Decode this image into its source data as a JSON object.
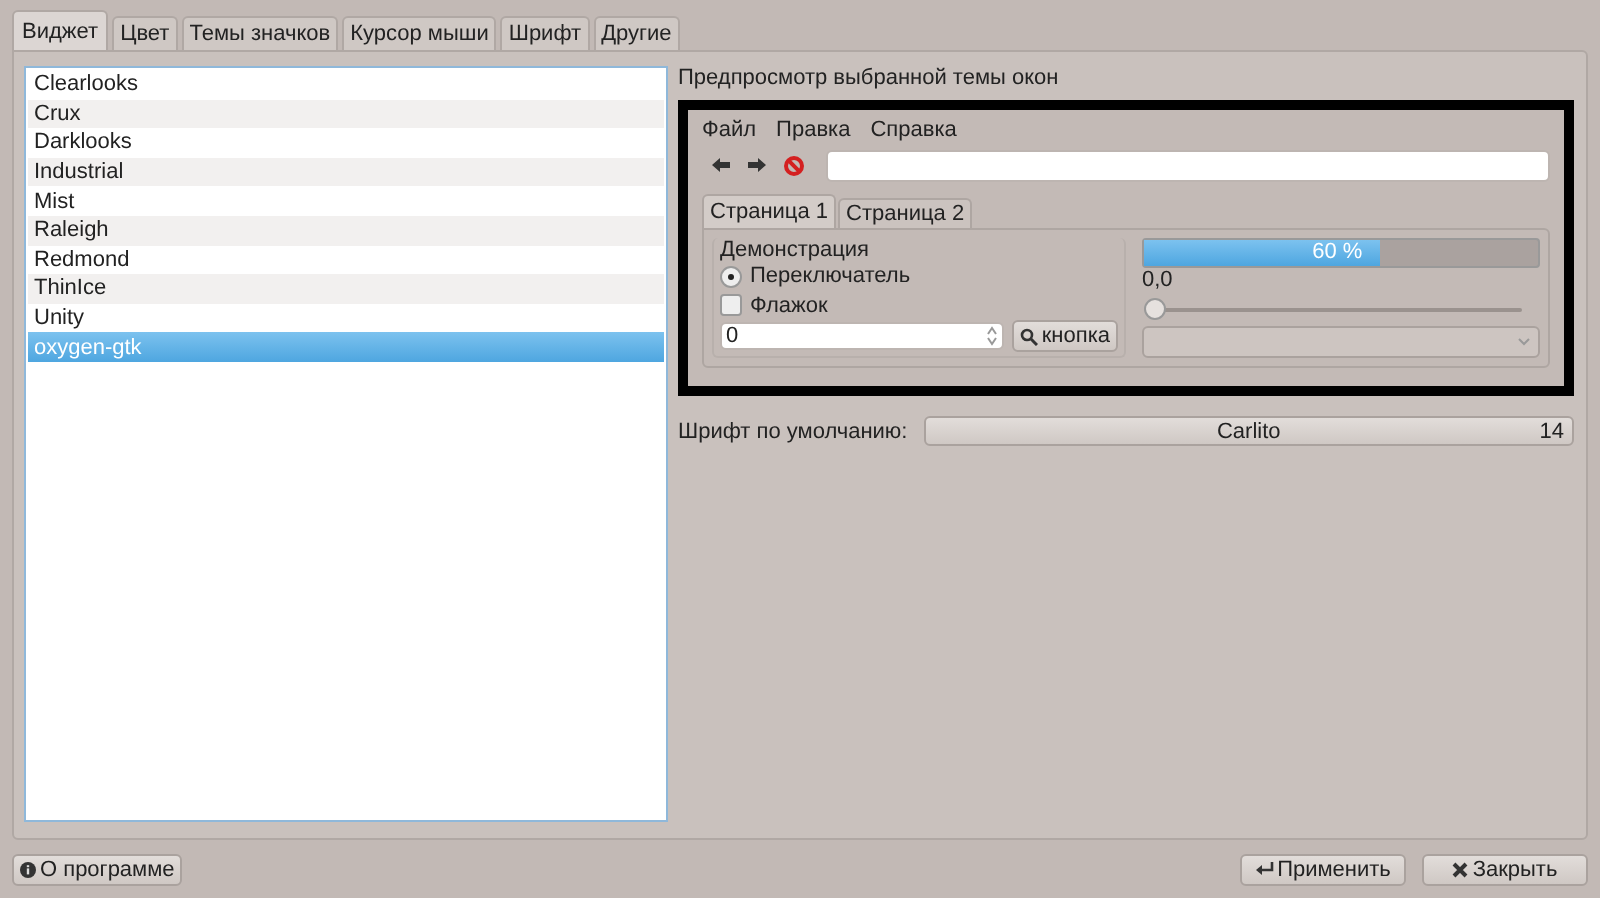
{
  "tabs": [
    {
      "label": "Виджет",
      "selected": true
    },
    {
      "label": "Цвет",
      "selected": false
    },
    {
      "label": "Темы значков",
      "selected": false
    },
    {
      "label": "Курсор мыши",
      "selected": false
    },
    {
      "label": "Шрифт",
      "selected": false
    },
    {
      "label": "Другие",
      "selected": false
    }
  ],
  "themes": [
    {
      "label": "Clearlooks",
      "selected": false
    },
    {
      "label": "Crux",
      "selected": false
    },
    {
      "label": "Darklooks",
      "selected": false
    },
    {
      "label": "Industrial",
      "selected": false
    },
    {
      "label": "Mist",
      "selected": false
    },
    {
      "label": "Raleigh",
      "selected": false
    },
    {
      "label": "Redmond",
      "selected": false
    },
    {
      "label": "ThinIce",
      "selected": false
    },
    {
      "label": "Unity",
      "selected": false
    },
    {
      "label": "oxygen-gtk",
      "selected": true
    }
  ],
  "preview": {
    "title": "Предпросмотр выбранной темы окон",
    "menu": [
      "Файл",
      "Правка",
      "Справка"
    ],
    "tabs": [
      {
        "label": "Страница 1",
        "selected": true
      },
      {
        "label": "Страница 2",
        "selected": false
      }
    ],
    "group": "Демонстрация",
    "radio": {
      "label": "Переключатель",
      "checked": true
    },
    "checkbox": {
      "label": "Флажок",
      "checked": false
    },
    "spin_value": "0",
    "button": "кнопка",
    "progress": {
      "level": 0.6,
      "text": "60 %"
    },
    "slider": {
      "reading": "0,0",
      "level": 0
    }
  },
  "font": {
    "label": "Шрифт по умолчанию:",
    "name": "Carlito",
    "size": "14"
  },
  "buttons": {
    "about": "О программе",
    "apply": "Применить",
    "close": "Закрыть"
  }
}
